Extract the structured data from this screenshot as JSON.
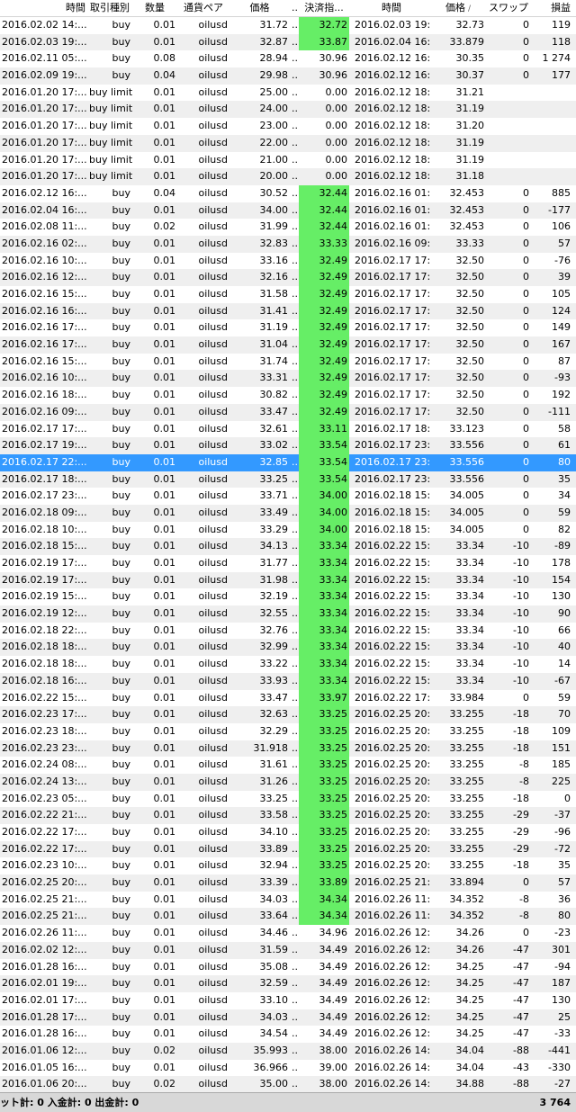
{
  "header": {
    "open_time": "時間",
    "type": "取引種別",
    "size": "数量",
    "symbol": "通貨ペア",
    "price": "価格",
    "ellipsis": "...",
    "tp": "決済指...",
    "close_time": "時間",
    "close_price": "価格",
    "swap": "スワップ",
    "profit": "損益"
  },
  "rows": [
    [
      "2016.02.02 14:...",
      "buy",
      "0.01",
      "oilusd",
      "31.72",
      "...",
      "32.72",
      "2016.02.03 19:...",
      "32.73",
      "0",
      "119"
    ],
    [
      "2016.02.03 19:...",
      "buy",
      "0.01",
      "oilusd",
      "32.87",
      "...",
      "33.87",
      "2016.02.04 16:...",
      "33.879",
      "0",
      "118"
    ],
    [
      "2016.02.11 05:...",
      "buy",
      "0.08",
      "oilusd",
      "28.94",
      "...",
      "30.96",
      "2016.02.12 16:...",
      "30.35",
      "0",
      "1 274"
    ],
    [
      "2016.02.09 19:...",
      "buy",
      "0.04",
      "oilusd",
      "29.98",
      "...",
      "30.96",
      "2016.02.12 16:...",
      "30.37",
      "0",
      "177"
    ],
    [
      "2016.01.20 17:...",
      "buy limit",
      "0.01",
      "oilusd",
      "25.00",
      "...",
      "0.00",
      "2016.02.12 18:...",
      "31.21",
      "",
      ""
    ],
    [
      "2016.01.20 17:...",
      "buy limit",
      "0.01",
      "oilusd",
      "24.00",
      "...",
      "0.00",
      "2016.02.12 18:...",
      "31.19",
      "",
      ""
    ],
    [
      "2016.01.20 17:...",
      "buy limit",
      "0.01",
      "oilusd",
      "23.00",
      "...",
      "0.00",
      "2016.02.12 18:...",
      "31.20",
      "",
      ""
    ],
    [
      "2016.01.20 17:...",
      "buy limit",
      "0.01",
      "oilusd",
      "22.00",
      "...",
      "0.00",
      "2016.02.12 18:...",
      "31.19",
      "",
      ""
    ],
    [
      "2016.01.20 17:...",
      "buy limit",
      "0.01",
      "oilusd",
      "21.00",
      "...",
      "0.00",
      "2016.02.12 18:...",
      "31.19",
      "",
      ""
    ],
    [
      "2016.01.20 17:...",
      "buy limit",
      "0.01",
      "oilusd",
      "20.00",
      "...",
      "0.00",
      "2016.02.12 18:...",
      "31.18",
      "",
      ""
    ],
    [
      "2016.02.12 16:...",
      "buy",
      "0.04",
      "oilusd",
      "30.52",
      "...",
      "32.44",
      "2016.02.16 01:...",
      "32.453",
      "0",
      "885"
    ],
    [
      "2016.02.04 16:...",
      "buy",
      "0.01",
      "oilusd",
      "34.00",
      "...",
      "32.44",
      "2016.02.16 01:...",
      "32.453",
      "0",
      "-177"
    ],
    [
      "2016.02.08 11:...",
      "buy",
      "0.02",
      "oilusd",
      "31.99",
      "...",
      "32.44",
      "2016.02.16 01:...",
      "32.453",
      "0",
      "106"
    ],
    [
      "2016.02.16 02:...",
      "buy",
      "0.01",
      "oilusd",
      "32.83",
      "...",
      "33.33",
      "2016.02.16 09:...",
      "33.33",
      "0",
      "57"
    ],
    [
      "2016.02.16 10:...",
      "buy",
      "0.01",
      "oilusd",
      "33.16",
      "...",
      "32.49",
      "2016.02.17 17:...",
      "32.50",
      "0",
      "-76"
    ],
    [
      "2016.02.16 12:...",
      "buy",
      "0.01",
      "oilusd",
      "32.16",
      "...",
      "32.49",
      "2016.02.17 17:...",
      "32.50",
      "0",
      "39"
    ],
    [
      "2016.02.16 15:...",
      "buy",
      "0.01",
      "oilusd",
      "31.58",
      "...",
      "32.49",
      "2016.02.17 17:...",
      "32.50",
      "0",
      "105"
    ],
    [
      "2016.02.16 16:...",
      "buy",
      "0.01",
      "oilusd",
      "31.41",
      "...",
      "32.49",
      "2016.02.17 17:...",
      "32.50",
      "0",
      "124"
    ],
    [
      "2016.02.16 17:...",
      "buy",
      "0.01",
      "oilusd",
      "31.19",
      "...",
      "32.49",
      "2016.02.17 17:...",
      "32.50",
      "0",
      "149"
    ],
    [
      "2016.02.16 17:...",
      "buy",
      "0.01",
      "oilusd",
      "31.04",
      "...",
      "32.49",
      "2016.02.17 17:...",
      "32.50",
      "0",
      "167"
    ],
    [
      "2016.02.16 15:...",
      "buy",
      "0.01",
      "oilusd",
      "31.74",
      "...",
      "32.49",
      "2016.02.17 17:...",
      "32.50",
      "0",
      "87"
    ],
    [
      "2016.02.16 10:...",
      "buy",
      "0.01",
      "oilusd",
      "33.31",
      "...",
      "32.49",
      "2016.02.17 17:...",
      "32.50",
      "0",
      "-93"
    ],
    [
      "2016.02.16 18:...",
      "buy",
      "0.01",
      "oilusd",
      "30.82",
      "...",
      "32.49",
      "2016.02.17 17:...",
      "32.50",
      "0",
      "192"
    ],
    [
      "2016.02.16 09:...",
      "buy",
      "0.01",
      "oilusd",
      "33.47",
      "...",
      "32.49",
      "2016.02.17 17:...",
      "32.50",
      "0",
      "-111"
    ],
    [
      "2016.02.17 17:...",
      "buy",
      "0.01",
      "oilusd",
      "32.61",
      "...",
      "33.11",
      "2016.02.17 18:...",
      "33.123",
      "0",
      "58"
    ],
    [
      "2016.02.17 19:...",
      "buy",
      "0.01",
      "oilusd",
      "33.02",
      "...",
      "33.54",
      "2016.02.17 23:...",
      "33.556",
      "0",
      "61"
    ],
    [
      "2016.02.17 22:...",
      "buy",
      "0.01",
      "oilusd",
      "32.85",
      "...",
      "33.54",
      "2016.02.17 23:...",
      "33.556",
      "0",
      "80"
    ],
    [
      "2016.02.17 18:...",
      "buy",
      "0.01",
      "oilusd",
      "33.25",
      "...",
      "33.54",
      "2016.02.17 23:...",
      "33.556",
      "0",
      "35"
    ],
    [
      "2016.02.17 23:...",
      "buy",
      "0.01",
      "oilusd",
      "33.71",
      "...",
      "34.00",
      "2016.02.18 15:...",
      "34.005",
      "0",
      "34"
    ],
    [
      "2016.02.18 09:...",
      "buy",
      "0.01",
      "oilusd",
      "33.49",
      "...",
      "34.00",
      "2016.02.18 15:...",
      "34.005",
      "0",
      "59"
    ],
    [
      "2016.02.18 10:...",
      "buy",
      "0.01",
      "oilusd",
      "33.29",
      "...",
      "34.00",
      "2016.02.18 15:...",
      "34.005",
      "0",
      "82"
    ],
    [
      "2016.02.18 15:...",
      "buy",
      "0.01",
      "oilusd",
      "34.13",
      "...",
      "33.34",
      "2016.02.22 15:...",
      "33.34",
      "-10",
      "-89"
    ],
    [
      "2016.02.19 17:...",
      "buy",
      "0.01",
      "oilusd",
      "31.77",
      "...",
      "33.34",
      "2016.02.22 15:...",
      "33.34",
      "-10",
      "178"
    ],
    [
      "2016.02.19 17:...",
      "buy",
      "0.01",
      "oilusd",
      "31.98",
      "...",
      "33.34",
      "2016.02.22 15:...",
      "33.34",
      "-10",
      "154"
    ],
    [
      "2016.02.19 15:...",
      "buy",
      "0.01",
      "oilusd",
      "32.19",
      "...",
      "33.34",
      "2016.02.22 15:...",
      "33.34",
      "-10",
      "130"
    ],
    [
      "2016.02.19 12:...",
      "buy",
      "0.01",
      "oilusd",
      "32.55",
      "...",
      "33.34",
      "2016.02.22 15:...",
      "33.34",
      "-10",
      "90"
    ],
    [
      "2016.02.18 22:...",
      "buy",
      "0.01",
      "oilusd",
      "32.76",
      "...",
      "33.34",
      "2016.02.22 15:...",
      "33.34",
      "-10",
      "66"
    ],
    [
      "2016.02.18 18:...",
      "buy",
      "0.01",
      "oilusd",
      "32.99",
      "...",
      "33.34",
      "2016.02.22 15:...",
      "33.34",
      "-10",
      "40"
    ],
    [
      "2016.02.18 18:...",
      "buy",
      "0.01",
      "oilusd",
      "33.22",
      "...",
      "33.34",
      "2016.02.22 15:...",
      "33.34",
      "-10",
      "14"
    ],
    [
      "2016.02.18 16:...",
      "buy",
      "0.01",
      "oilusd",
      "33.93",
      "...",
      "33.34",
      "2016.02.22 15:...",
      "33.34",
      "-10",
      "-67"
    ],
    [
      "2016.02.22 15:...",
      "buy",
      "0.01",
      "oilusd",
      "33.47",
      "...",
      "33.97",
      "2016.02.22 17:...",
      "33.984",
      "0",
      "59"
    ],
    [
      "2016.02.23 17:...",
      "buy",
      "0.01",
      "oilusd",
      "32.63",
      "...",
      "33.25",
      "2016.02.25 20:...",
      "33.255",
      "-18",
      "70"
    ],
    [
      "2016.02.23 18:...",
      "buy",
      "0.01",
      "oilusd",
      "32.29",
      "...",
      "33.25",
      "2016.02.25 20:...",
      "33.255",
      "-18",
      "109"
    ],
    [
      "2016.02.23 23:...",
      "buy",
      "0.01",
      "oilusd",
      "31.918",
      "...",
      "33.25",
      "2016.02.25 20:...",
      "33.255",
      "-18",
      "151"
    ],
    [
      "2016.02.24 08:...",
      "buy",
      "0.01",
      "oilusd",
      "31.61",
      "...",
      "33.25",
      "2016.02.25 20:...",
      "33.255",
      "-8",
      "185"
    ],
    [
      "2016.02.24 13:...",
      "buy",
      "0.01",
      "oilusd",
      "31.26",
      "...",
      "33.25",
      "2016.02.25 20:...",
      "33.255",
      "-8",
      "225"
    ],
    [
      "2016.02.23 05:...",
      "buy",
      "0.01",
      "oilusd",
      "33.25",
      "...",
      "33.25",
      "2016.02.25 20:...",
      "33.255",
      "-18",
      "0"
    ],
    [
      "2016.02.22 21:...",
      "buy",
      "0.01",
      "oilusd",
      "33.58",
      "...",
      "33.25",
      "2016.02.25 20:...",
      "33.255",
      "-29",
      "-37"
    ],
    [
      "2016.02.22 17:...",
      "buy",
      "0.01",
      "oilusd",
      "34.10",
      "...",
      "33.25",
      "2016.02.25 20:...",
      "33.255",
      "-29",
      "-96"
    ],
    [
      "2016.02.22 17:...",
      "buy",
      "0.01",
      "oilusd",
      "33.89",
      "...",
      "33.25",
      "2016.02.25 20:...",
      "33.255",
      "-29",
      "-72"
    ],
    [
      "2016.02.23 10:...",
      "buy",
      "0.01",
      "oilusd",
      "32.94",
      "...",
      "33.25",
      "2016.02.25 20:...",
      "33.255",
      "-18",
      "35"
    ],
    [
      "2016.02.25 20:...",
      "buy",
      "0.01",
      "oilusd",
      "33.39",
      "...",
      "33.89",
      "2016.02.25 21:...",
      "33.894",
      "0",
      "57"
    ],
    [
      "2016.02.25 21:...",
      "buy",
      "0.01",
      "oilusd",
      "34.03",
      "...",
      "34.34",
      "2016.02.26 11:...",
      "34.352",
      "-8",
      "36"
    ],
    [
      "2016.02.25 21:...",
      "buy",
      "0.01",
      "oilusd",
      "33.64",
      "...",
      "34.34",
      "2016.02.26 11:...",
      "34.352",
      "-8",
      "80"
    ],
    [
      "2016.02.26 11:...",
      "buy",
      "0.01",
      "oilusd",
      "34.46",
      "...",
      "34.96",
      "2016.02.26 12:...",
      "34.26",
      "0",
      "-23"
    ],
    [
      "2016.02.02 12:...",
      "buy",
      "0.01",
      "oilusd",
      "31.59",
      "...",
      "34.49",
      "2016.02.26 12:...",
      "34.26",
      "-47",
      "301"
    ],
    [
      "2016.01.28 16:...",
      "buy",
      "0.01",
      "oilusd",
      "35.08",
      "...",
      "34.49",
      "2016.02.26 12:...",
      "34.25",
      "-47",
      "-94"
    ],
    [
      "2016.02.01 19:...",
      "buy",
      "0.01",
      "oilusd",
      "32.59",
      "...",
      "34.49",
      "2016.02.26 12:...",
      "34.25",
      "-47",
      "187"
    ],
    [
      "2016.02.01 17:...",
      "buy",
      "0.01",
      "oilusd",
      "33.10",
      "...",
      "34.49",
      "2016.02.26 12:...",
      "34.25",
      "-47",
      "130"
    ],
    [
      "2016.01.28 17:...",
      "buy",
      "0.01",
      "oilusd",
      "34.03",
      "...",
      "34.49",
      "2016.02.26 12:...",
      "34.25",
      "-47",
      "25"
    ],
    [
      "2016.01.28 16:...",
      "buy",
      "0.01",
      "oilusd",
      "34.54",
      "...",
      "34.49",
      "2016.02.26 12:...",
      "34.25",
      "-47",
      "-33"
    ],
    [
      "2016.01.06 12:...",
      "buy",
      "0.02",
      "oilusd",
      "35.993",
      "...",
      "38.00",
      "2016.02.26 14:...",
      "34.04",
      "-88",
      "-441"
    ],
    [
      "2016.01.05 16:...",
      "buy",
      "0.01",
      "oilusd",
      "36.966",
      "...",
      "39.00",
      "2016.02.26 14:...",
      "34.04",
      "-43",
      "-330"
    ],
    [
      "2016.01.06 20:...",
      "buy",
      "0.02",
      "oilusd",
      "35.00",
      "...",
      "38.00",
      "2016.02.26 14:...",
      "34.88",
      "-88",
      "-27"
    ]
  ],
  "green_rows": [
    0,
    1,
    10,
    11,
    12,
    13,
    14,
    15,
    16,
    17,
    18,
    19,
    20,
    21,
    22,
    23,
    24,
    25,
    26,
    27,
    28,
    29,
    30,
    31,
    32,
    33,
    34,
    35,
    36,
    37,
    38,
    39,
    40,
    41,
    42,
    43,
    44,
    45,
    46,
    47,
    48,
    49,
    50,
    51,
    52,
    53
  ],
  "selected_row": 26,
  "footer": {
    "left": "ット計: 0  入金計: 0  出金計: 0",
    "total": "3 764"
  },
  "colors": {
    "green_cell": "#66ee66",
    "selected": "#3399ff",
    "alt_row": "#efefef"
  }
}
